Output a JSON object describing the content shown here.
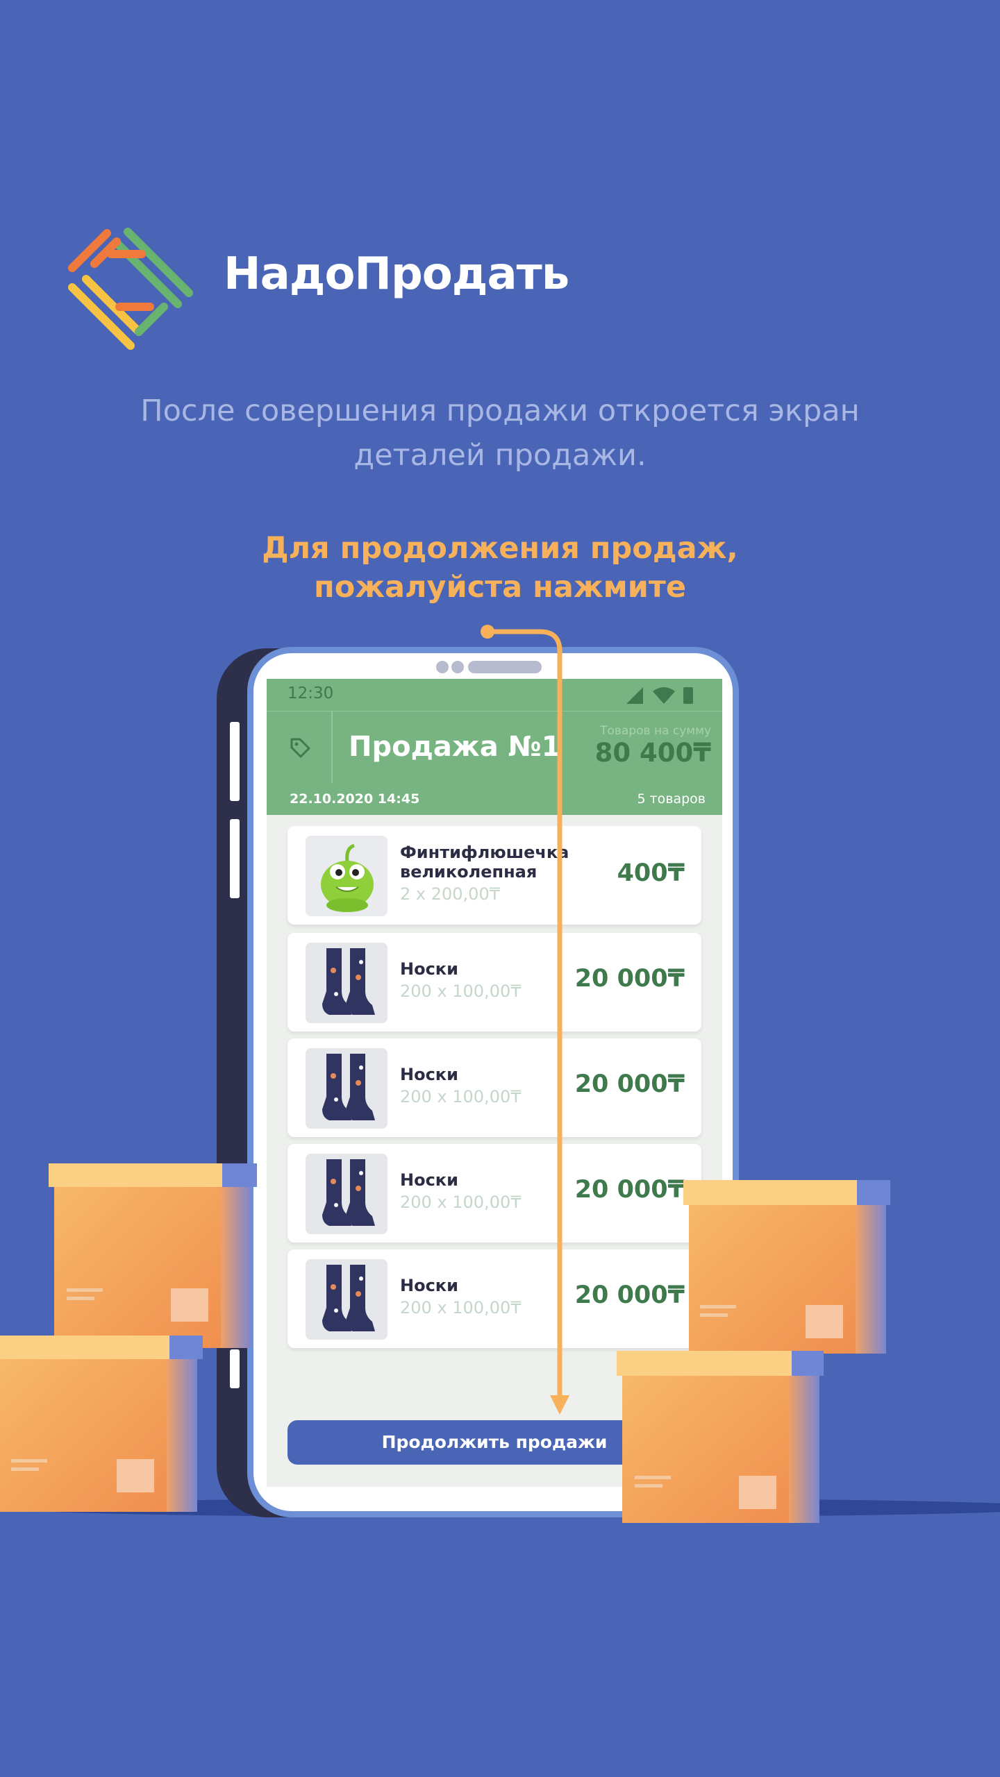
{
  "brand": {
    "name": "НадоПродать",
    "colors": {
      "orange": "#ef7a3c",
      "green": "#67b36f",
      "yellow": "#f6c343"
    }
  },
  "intro": {
    "subtitle": "После совершения продажи откроется экран деталей продажи.",
    "cta": "Для продолжения продаж, пожалуйста нажмите"
  },
  "phone": {
    "status_time": "12:30",
    "sale_title": "Продажа №1",
    "total_label": "Товаров на сумму",
    "total_value": "80 400₸",
    "date": "22.10.2020  14:45",
    "items_count": "5 товаров",
    "items": [
      {
        "name": "Финтифлюшечка великолепная",
        "qty": "2 x 200,00₸",
        "price": "400₸",
        "image": "green-toy"
      },
      {
        "name": "Носки",
        "qty": "200 x 100,00₸",
        "price": "20 000₸",
        "image": "socks"
      },
      {
        "name": "Носки",
        "qty": "200 x 100,00₸",
        "price": "20 000₸",
        "image": "socks"
      },
      {
        "name": "Носки",
        "qty": "200 x 100,00₸",
        "price": "20 000₸",
        "image": "socks"
      },
      {
        "name": "Носки",
        "qty": "200 x 100,00₸",
        "price": "20 000₸",
        "image": "socks"
      }
    ],
    "continue_button": "Продолжить продажи"
  },
  "colors": {
    "background": "#4a65b6",
    "header_green": "#78b482",
    "price_green": "#3f7a4d",
    "accent_orange": "#f6b15a"
  }
}
